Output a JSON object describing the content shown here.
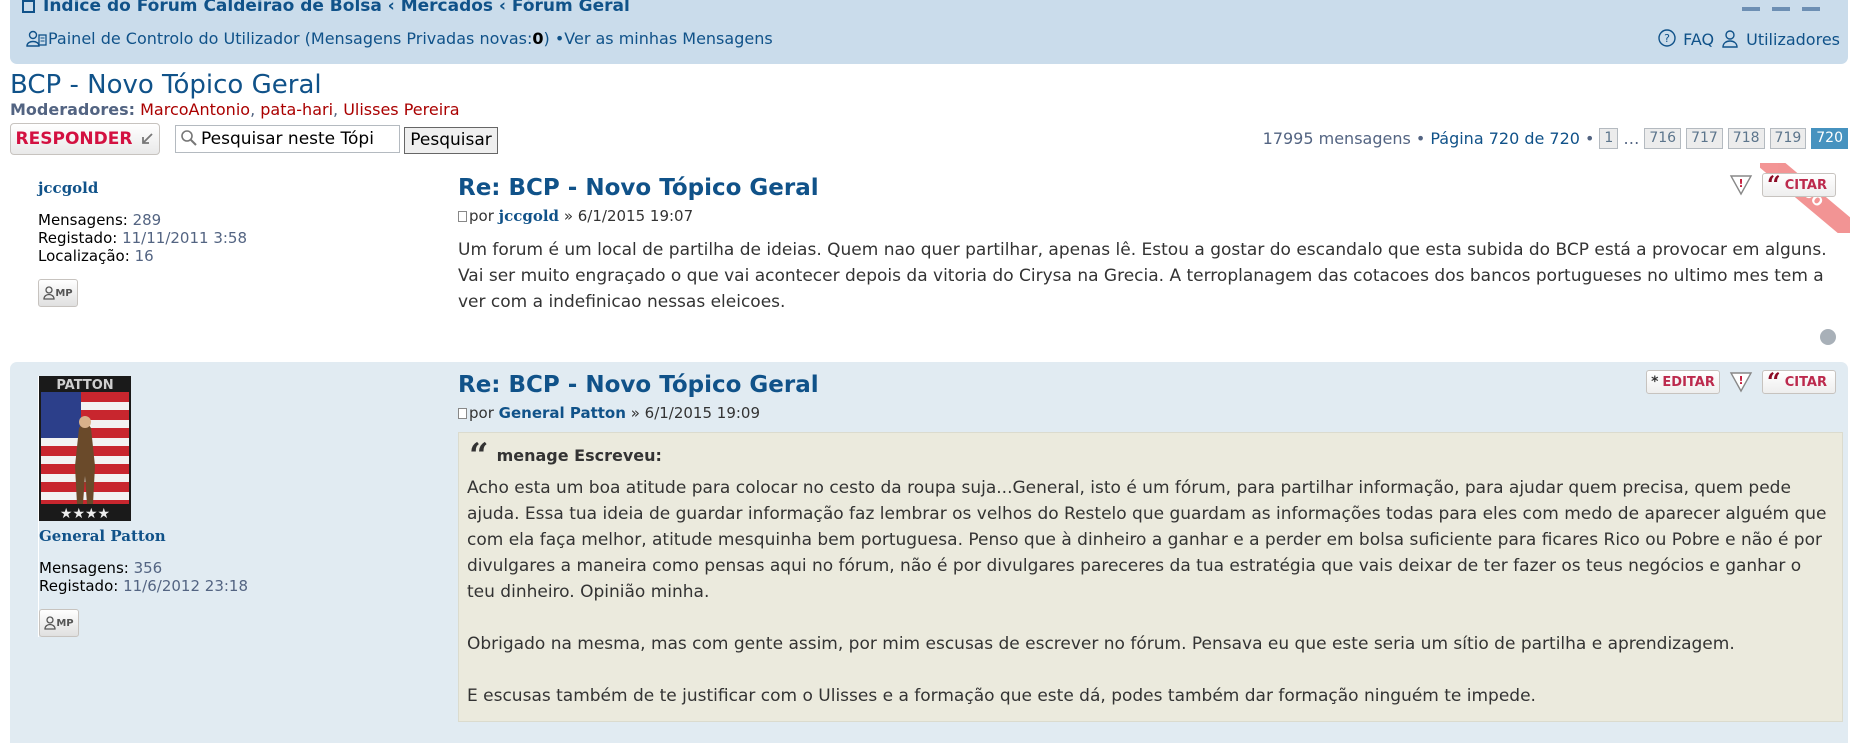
{
  "navbar": {
    "breadcrumb": "Índice do Fórum Caldeirão de Bolsa ‹ Mercados ‹ Fórum Geral",
    "ucp_label": "Painel de Controlo do Utilizador (Mensagens Privadas novas: ",
    "pm_count": "0",
    "ucp_suffix": ") • ",
    "view_messages": "Ver as minhas Mensagens",
    "faq": "FAQ",
    "members": "Utilizadores"
  },
  "forum": {
    "title": "BCP - Novo Tópico Geral",
    "moderators_label": "Moderadores:",
    "moderators": [
      "MarcoAntonio",
      "pata-hari",
      "Ulisses Pereira"
    ]
  },
  "actionbar": {
    "reply_label": "RESPONDER",
    "search_placeholder": "Pesquisar neste Tópi",
    "search_button": "Pesquisar",
    "post_count_text": "17995 mensagens •",
    "page_text": "Página 720 de 720",
    "bullet": "•",
    "pages": [
      "1",
      "…",
      "716",
      "717",
      "718",
      "719",
      "720"
    ],
    "current_page": "720"
  },
  "posts": [
    {
      "author": "jccgold",
      "stats": [
        {
          "label": "Mensagens:",
          "value": "289"
        },
        {
          "label": "Registado:",
          "value": "11/11/2011 3:58"
        },
        {
          "label": "Localização:",
          "value": "16"
        }
      ],
      "title": "Re: BCP - Novo Tópico Geral",
      "by": "por",
      "date": "» 6/1/2015 19:07",
      "content": "Um forum é um local de partilha de ideias. Quem nao quer partilhar, apenas lê. Estou a gostar do escandalo que esta subida do BCP está a provocar em alguns. Vai ser muito engraçado o que vai acontecer depois da vitoria do Cirysa na Grecia. A terroplanagem das cotacoes dos bancos portugueses no ultimo mes tem a ver com a indefinicao nessas eleicoes.",
      "quote_btn": "CITAR",
      "ribbon": "ADO"
    },
    {
      "author": "General Patton",
      "avatar_text": "PATTON",
      "stats": [
        {
          "label": "Mensagens:",
          "value": "356"
        },
        {
          "label": "Registado:",
          "value": "11/6/2012 23:18"
        }
      ],
      "title": "Re: BCP - Novo Tópico Geral",
      "by": "por",
      "date": "» 6/1/2015 19:09",
      "edit_btn": "EDITAR",
      "quote_btn": "CITAR",
      "quote": {
        "cite": "menage Escreveu:",
        "p1": "Acho esta um boa atitude para colocar no cesto da roupa suja...General, isto é um fórum, para partilhar informação, para ajudar quem precisa, quem pede ajuda. Essa tua ideia de guardar informação faz lembrar os velhos do Restelo que guardam as informações todas para eles com medo de aparecer alguém que com ela faça melhor, atitude mesquinha bem portuguesa. Penso que à dinheiro a ganhar e a perder em bolsa suficiente para ficares Rico ou Pobre e não é por divulgares a maneira como pensas aqui no fórum, não é por divulgares pareceres da tua estratégia que vais deixar de ter fazer os teus negócios e ganhar o teu dinheiro. Opinião minha.",
        "p2": "Obrigado na mesma, mas com gente assim, por mim escusas de escrever no fórum. Pensava eu que este seria um sítio de partilha e aprendizagem.",
        "p3": "E escusas também de te justificar com o Ulisses e a formação que este dá, podes também dar formação ninguém te impede."
      }
    }
  ],
  "pm_button_label": "MP",
  "colors": {
    "link": "#105289",
    "navbar_bg": "#cadceb",
    "post_alt_bg": "#e1ebf2",
    "quote_bg": "#ebeadd",
    "reply_red": "#d31141",
    "moderator_red": "#aa0000",
    "active_page": "#4692bf"
  }
}
